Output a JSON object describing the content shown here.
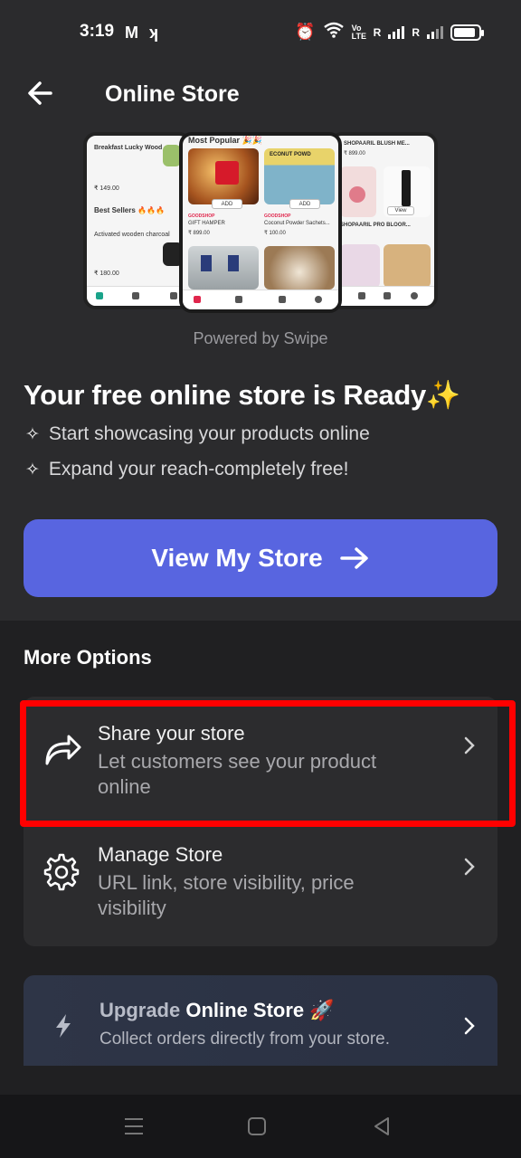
{
  "status_bar": {
    "time": "3:19",
    "network_label": "Vo LTE",
    "signal1_label": "R",
    "signal2_label": "R",
    "battery_level": 0.9
  },
  "header": {
    "title": "Online Store",
    "back_icon": "arrow-left-icon"
  },
  "hero": {
    "left_phone": {
      "item1": "Breakfast Lucky Wood",
      "price1": "₹ 149.00",
      "section": "Best Sellers 🔥🔥🔥",
      "item2": "Activated wooden charcoal",
      "price2": "₹ 180.00"
    },
    "center_phone": {
      "section": "Most Popular 🎉🎉",
      "product1_tag": "GOODSHOP",
      "product1_name": "GIFT HAMPER",
      "product1_price": "₹ 899.00",
      "product2_tag": "GOODSHOP",
      "product2_name": "Coconut Powder Sachets...",
      "product2_price": "₹ 100.00",
      "add_label": "ADD",
      "banner_text": "ECONUT POWD"
    },
    "right_phone": {
      "item1": "SHOPAARIL BLUSH ME...",
      "price1": "₹ 899.00",
      "item2": "SHOPAARIL PRO BLOOR...",
      "view_label": "View"
    }
  },
  "powered_by": "Powered by Swipe",
  "promo": {
    "title": "Your free online store is Ready✨",
    "features": [
      "Start showcasing your products online",
      "Expand your reach-completely free!"
    ],
    "cta_label": "View My Store"
  },
  "more_options": {
    "title": "More Options",
    "items": [
      {
        "title": "Share your store",
        "description": "Let customers see your product online",
        "icon": "share-arrow-icon"
      },
      {
        "title": "Manage Store",
        "description": "URL link, store visibility, price visibility",
        "icon": "gear-icon"
      }
    ],
    "upgrade": {
      "title_dim": "Upgrade",
      "title_bright": "Online Store 🚀",
      "description": "Collect orders directly from your store.",
      "icon": "lightning-icon"
    }
  },
  "colors": {
    "background": "#2b2b2d",
    "cta": "#5865e0",
    "highlight": "#ff0000",
    "card": "#2c2c2e"
  }
}
